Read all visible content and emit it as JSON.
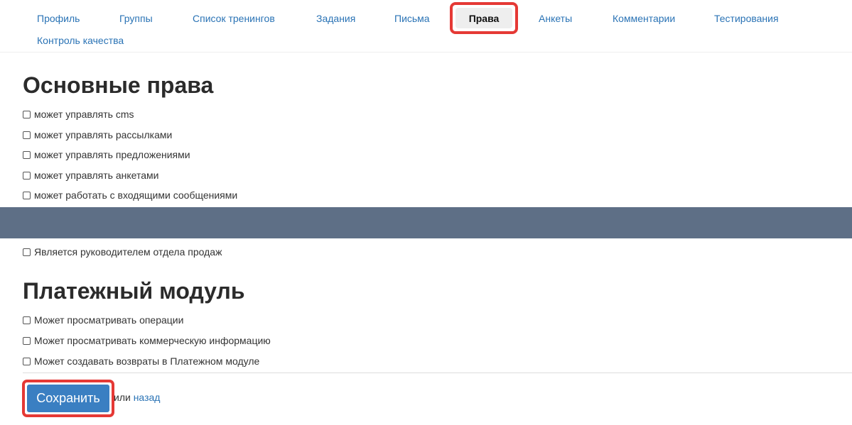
{
  "tabs": {
    "items": [
      {
        "label": "Профиль"
      },
      {
        "label": "Группы"
      },
      {
        "label": "Список тренингов"
      },
      {
        "label": "Задания"
      },
      {
        "label": "Письма"
      },
      {
        "label": "Права",
        "active": true
      },
      {
        "label": "Анкеты"
      },
      {
        "label": "Комментарии"
      },
      {
        "label": "Тестирования"
      },
      {
        "label": "Контроль качества"
      }
    ]
  },
  "main_rights": {
    "title": "Основные права",
    "items": [
      {
        "label": "может управлять cms",
        "checked": false
      },
      {
        "label": "может управлять рассылками",
        "checked": false
      },
      {
        "label": "может управлять предложениями",
        "checked": false
      },
      {
        "label": "может управлять анкетами",
        "checked": false
      },
      {
        "label": "может работать с входящими сообщениями",
        "checked": false
      }
    ]
  },
  "sales": {
    "label": "Является руководителем отдела продаж",
    "checked": false
  },
  "payment_module": {
    "title": "Платежный модуль",
    "items": [
      {
        "label": "Может просматривать операции",
        "checked": false
      },
      {
        "label": "Может просматривать коммерческую информацию",
        "checked": false
      },
      {
        "label": "Может создавать возвраты в Платежном модуле",
        "checked": false
      }
    ]
  },
  "footer": {
    "save_label": "Сохранить",
    "or_text": "или",
    "back_label": "назад"
  },
  "colors": {
    "link": "#2a73b5",
    "banner": "#5e6f86",
    "highlight": "#e53935",
    "save_button": "#3a7fc2"
  }
}
